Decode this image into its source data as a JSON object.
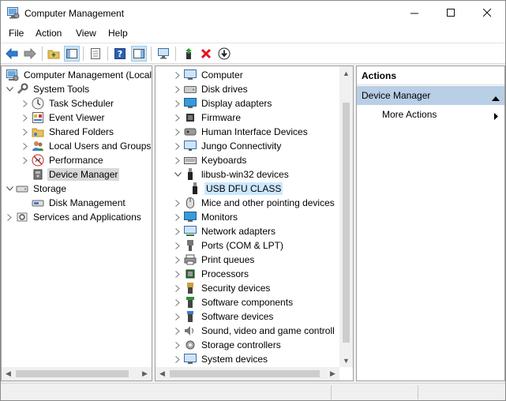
{
  "window": {
    "title": "Computer Management"
  },
  "menu": {
    "file": "File",
    "action": "Action",
    "view": "View",
    "help": "Help"
  },
  "left_tree": [
    {
      "label": "Computer Management (Local"
    },
    {
      "label": "System Tools"
    },
    {
      "label": "Task Scheduler"
    },
    {
      "label": "Event Viewer"
    },
    {
      "label": "Shared Folders"
    },
    {
      "label": "Local Users and Groups"
    },
    {
      "label": "Performance"
    },
    {
      "label": "Device Manager"
    },
    {
      "label": "Storage"
    },
    {
      "label": "Disk Management"
    },
    {
      "label": "Services and Applications"
    }
  ],
  "devices": [
    {
      "label": "Computer"
    },
    {
      "label": "Disk drives"
    },
    {
      "label": "Display adapters"
    },
    {
      "label": "Firmware"
    },
    {
      "label": "Human Interface Devices"
    },
    {
      "label": "Jungo Connectivity"
    },
    {
      "label": "Keyboards"
    },
    {
      "label": "libusb-win32 devices"
    },
    {
      "label": "USB DFU CLASS"
    },
    {
      "label": "Mice and other pointing devices"
    },
    {
      "label": "Monitors"
    },
    {
      "label": "Network adapters"
    },
    {
      "label": "Ports (COM & LPT)"
    },
    {
      "label": "Print queues"
    },
    {
      "label": "Processors"
    },
    {
      "label": "Security devices"
    },
    {
      "label": "Software components"
    },
    {
      "label": "Software devices"
    },
    {
      "label": "Sound, video and game controll"
    },
    {
      "label": "Storage controllers"
    },
    {
      "label": "System devices"
    }
  ],
  "actions": {
    "header": "Actions",
    "section": "Device Manager",
    "more": "More Actions"
  },
  "colors": {
    "selection_blue": "#cce8ff",
    "section_blue": "#b8cfe6",
    "delete_red": "#e81123"
  }
}
